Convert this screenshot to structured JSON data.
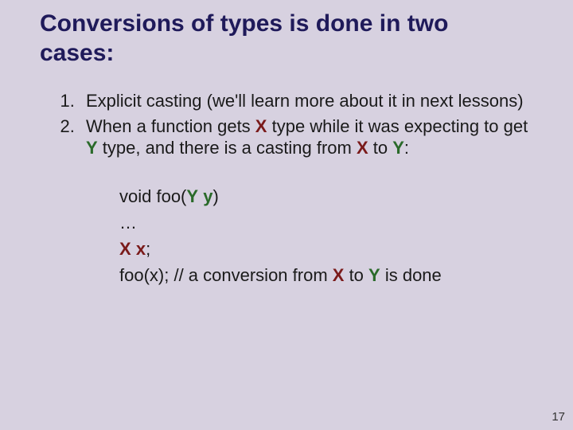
{
  "title": "Conversions of types is done in two cases:",
  "list": {
    "item1": "Explicit casting (we'll learn more about it in next lessons)",
    "item2_a": "When a function gets ",
    "item2_b": " type while it was expecting to get ",
    "item2_c": " type, and there is a casting from ",
    "item2_d": " to ",
    "item2_e": ":"
  },
  "sym": {
    "X": "X",
    "Y": "Y",
    "x": "x",
    "y": "y"
  },
  "code": {
    "l1a": "void foo(",
    "l1b": ")",
    "l2": "…",
    "l3b": ";",
    "l4a": "foo(x); // a conversion from ",
    "l4b": " to ",
    "l4c": " is done"
  },
  "page": "17"
}
